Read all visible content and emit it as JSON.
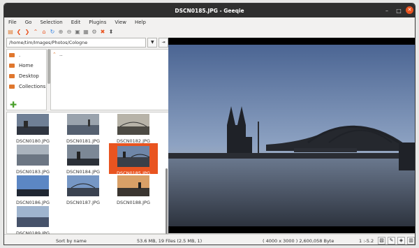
{
  "window": {
    "title": "DSCN0185.JPG - Geeqie"
  },
  "menu": [
    "File",
    "Go",
    "Selection",
    "Edit",
    "Plugins",
    "View",
    "Help"
  ],
  "path": {
    "value": "/home/tim/Images/Photos/Cologne"
  },
  "tree": {
    "items": [
      ".",
      "Home",
      "Desktop",
      "Collections"
    ]
  },
  "dirlist": {
    "up_label": "..",
    "dot_label": ""
  },
  "thumbnails": [
    "DSCN0180.JPG",
    "DSCN0181.JPG",
    "DSCN0182.JPG",
    "DSCN0183.JPG",
    "DSCN0184.JPG",
    "DSCN0185.JPG",
    "DSCN0186.JPG",
    "DSCN0187.JPG",
    "DSCN0188.JPG",
    "DSCN0189.JPG"
  ],
  "selected_thumbnail": "DSCN0185.JPG",
  "status": {
    "sort": "Sort by name",
    "files": "53.6 MB, 19 Files (2.5 MB, 1)",
    "image_info": "( 4000 x 3000 ) 2,600,058 Byte",
    "zoom": "1 :-5.2"
  },
  "colors": {
    "accent": "#e95420",
    "titlebar": "#2f2f2f",
    "folder": "#e0772e"
  }
}
